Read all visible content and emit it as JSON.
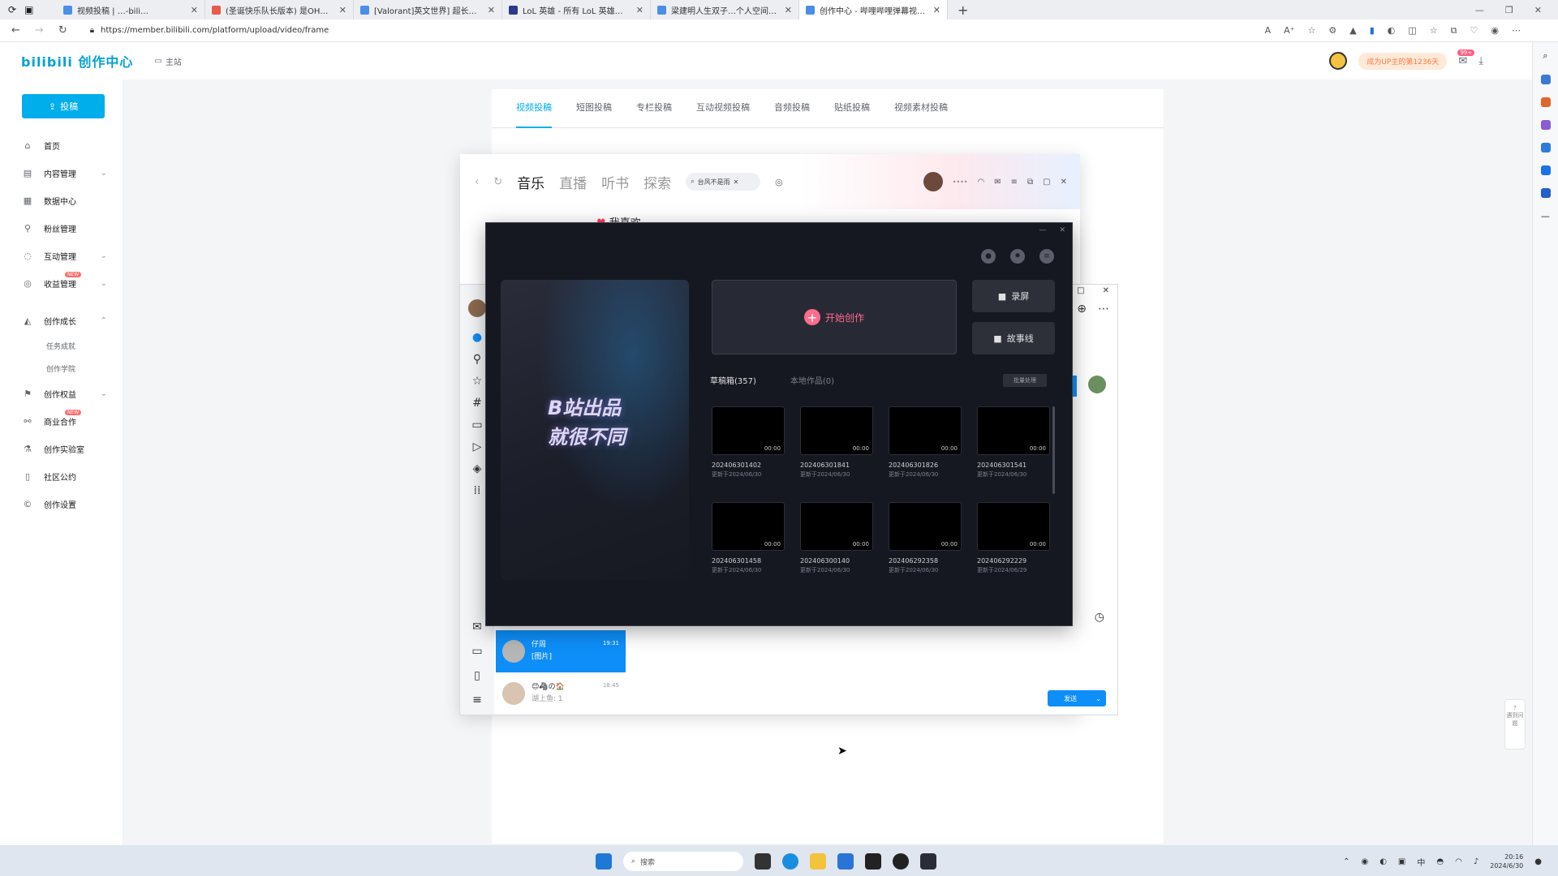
{
  "browser": {
    "tabs": [
      {
        "title": "视频投稿 | …-bili…"
      },
      {
        "title": "(圣诞快乐队长版本) 是OH免2…"
      },
      {
        "title": "[Valorant]英文世界] 超长完…"
      },
      {
        "title": "LoL 英雄 - 所有 LoL 英雄…"
      },
      {
        "title": "梁建明人生双子…个人空间…"
      },
      {
        "title": "创作中心 - 哔哩哔哩弹幕视频网"
      }
    ],
    "url": "https://member.bilibili.com/platform/upload/video/frame"
  },
  "header": {
    "logo": "bilibili 创作中心",
    "home": "主站",
    "promo": "成为UP主的第1236天",
    "badge": "99+"
  },
  "sidebar": {
    "upload": "投稿",
    "items": [
      {
        "label": "首页",
        "icon": "home-icon"
      },
      {
        "label": "内容管理",
        "icon": "doc-icon",
        "expand": true
      },
      {
        "label": "数据中心",
        "icon": "chart-icon"
      },
      {
        "label": "粉丝管理",
        "icon": "user-icon"
      },
      {
        "label": "互动管理",
        "icon": "chat-icon",
        "expand": true
      },
      {
        "label": "收益管理",
        "icon": "coin-icon",
        "expand": true,
        "badge": "NEW"
      },
      {
        "label": "创作成长",
        "icon": "cap-icon",
        "expand": true
      },
      {
        "label": "任务成就",
        "sub": true
      },
      {
        "label": "创作学院",
        "sub": true
      },
      {
        "label": "创作权益",
        "icon": "flag-icon",
        "expand": true
      },
      {
        "label": "商业合作",
        "icon": "handshake-icon",
        "badge": "NEW"
      },
      {
        "label": "创作实验室",
        "icon": "flask-icon"
      },
      {
        "label": "社区公约",
        "icon": "book-icon"
      },
      {
        "label": "创作设置",
        "icon": "copyright-icon"
      }
    ]
  },
  "content_tabs": [
    "视频投稿",
    "短图投稿",
    "专栏投稿",
    "互动视频投稿",
    "音频投稿",
    "贴纸投稿",
    "视频素材投稿"
  ],
  "music": {
    "tabs": [
      "音乐",
      "直播",
      "听书",
      "探索"
    ],
    "search": "台风不是雨",
    "fav": "我喜欢"
  },
  "creator": {
    "poster_line1": "B站出品",
    "poster_line2": "就很不同",
    "start": "开始创作",
    "record": "录屏",
    "story": "故事线",
    "drafts_tab": "草稿箱(357)",
    "local_tab": "本地作品(0)",
    "batch": "批量处理",
    "cards": [
      {
        "name": "202406301402",
        "date": "更新于2024/06/30",
        "dur": "00:00"
      },
      {
        "name": "202406301841",
        "date": "更新于2024/06/30",
        "dur": "00:00"
      },
      {
        "name": "202406301826",
        "date": "更新于2024/06/30",
        "dur": "00:00"
      },
      {
        "name": "202406301541",
        "date": "更新于2024/06/30",
        "dur": "00:00"
      },
      {
        "name": "202406301458",
        "date": "更新于2024/06/30",
        "dur": "00:00"
      },
      {
        "name": "202406300140",
        "date": "更新于2024/06/30",
        "dur": "00:00"
      },
      {
        "name": "202406292358",
        "date": "更新于2024/06/30",
        "dur": "00:00"
      },
      {
        "name": "202406292229",
        "date": "更新于2024/06/29",
        "dur": "00:00"
      }
    ]
  },
  "chat": {
    "items": [
      {
        "name": "仔周",
        "msg": "[图片]",
        "time": "19:31"
      },
      {
        "name": "😊🦓の🏠",
        "msg": "湖上鱼: 1",
        "time": "18:45"
      }
    ],
    "send": "发送"
  },
  "help": "遇到问题",
  "taskbar": {
    "search": "搜索",
    "time": "20:16",
    "date": "2024/6/30"
  }
}
